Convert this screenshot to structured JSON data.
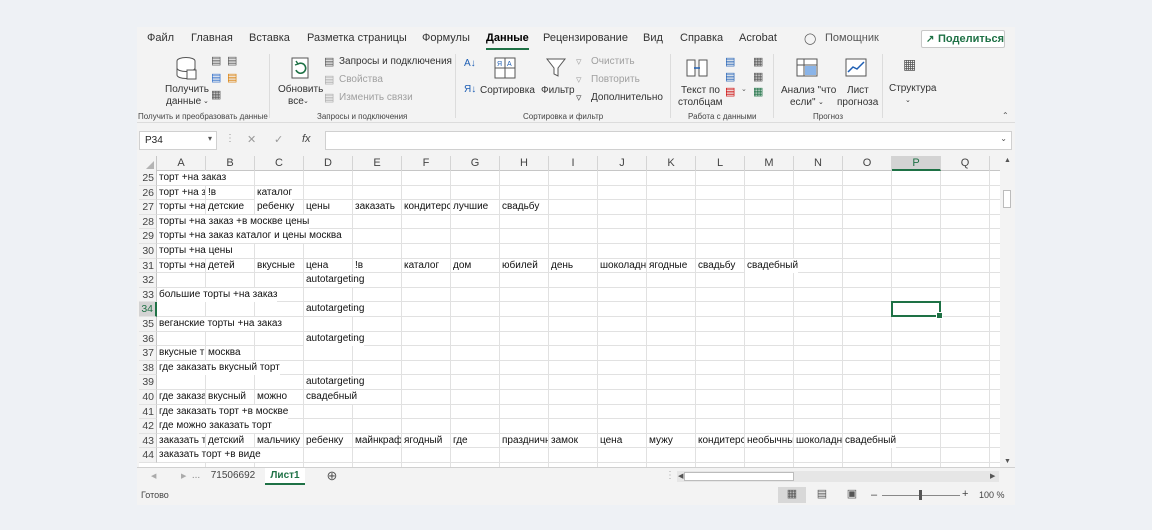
{
  "menu": {
    "tabs": [
      "Файл",
      "Главная",
      "Вставка",
      "Разметка страницы",
      "Формулы",
      "Данные",
      "Рецензирование",
      "Вид",
      "Справка",
      "Acrobat"
    ],
    "active_tab": "Данные",
    "tell_me": "Помощник",
    "share": "Поделиться"
  },
  "ribbon": {
    "get_data": "Получить",
    "get_data2": "данные",
    "group1": "Получить и преобразовать данные",
    "refresh_all": "Обновить",
    "refresh_all2": "все",
    "queries_connections": "Запросы и подключения",
    "properties": "Свойства",
    "edit_links": "Изменить связи",
    "group2": "Запросы и подключения",
    "sort": "Сортировка",
    "filter": "Фильтр",
    "clear": "Очистить",
    "reapply": "Повторить",
    "advanced": "Дополнительно",
    "group3": "Сортировка и фильтр",
    "text_to_columns": "Текст по",
    "text_to_columns2": "столбцам",
    "group4": "Работа с данными",
    "what_if": "Анализ \"что",
    "what_if2": "если\"",
    "forecast_sheet": "Лист",
    "forecast_sheet2": "прогноза",
    "group5": "Прогноз",
    "outline": "Структура"
  },
  "formula_bar": {
    "name_box": "P34",
    "formula": ""
  },
  "grid": {
    "columns": [
      "A",
      "B",
      "C",
      "D",
      "E",
      "F",
      "G",
      "H",
      "I",
      "J",
      "K",
      "L",
      "M",
      "N",
      "O",
      "P",
      "Q"
    ],
    "selected_column": "P",
    "selected_row": "34",
    "rows": [
      {
        "num": "25",
        "cells": [
          [
            "A",
            "торт +на заказ"
          ]
        ]
      },
      {
        "num": "26",
        "cells": [
          [
            "A",
            "торт +на з"
          ],
          [
            "B",
            "!в"
          ],
          [
            "C",
            "каталог"
          ]
        ]
      },
      {
        "num": "27",
        "cells": [
          [
            "A",
            "торты +на"
          ],
          [
            "B",
            "детские"
          ],
          [
            "C",
            "ребенку"
          ],
          [
            "D",
            "цены"
          ],
          [
            "E",
            "заказать"
          ],
          [
            "F",
            "кондитерс"
          ],
          [
            "G",
            "лучшие"
          ],
          [
            "H",
            "свадьбу"
          ]
        ]
      },
      {
        "num": "28",
        "cells": [
          [
            "A",
            "торты +на заказ +в москве цены"
          ]
        ]
      },
      {
        "num": "29",
        "cells": [
          [
            "A",
            "торты +на заказ каталог и цены москва"
          ]
        ]
      },
      {
        "num": "30",
        "cells": [
          [
            "A",
            "торты +на цены"
          ]
        ]
      },
      {
        "num": "31",
        "cells": [
          [
            "A",
            "торты +на"
          ],
          [
            "B",
            "детей"
          ],
          [
            "C",
            "вкусные"
          ],
          [
            "D",
            "цена"
          ],
          [
            "E",
            "!в"
          ],
          [
            "F",
            "каталог"
          ],
          [
            "G",
            "дом"
          ],
          [
            "H",
            "юбилей"
          ],
          [
            "I",
            "день"
          ],
          [
            "J",
            "шоколадн"
          ],
          [
            "K",
            "ягодные"
          ],
          [
            "L",
            "свадьбу"
          ],
          [
            "M",
            "свадебный"
          ]
        ]
      },
      {
        "num": "32",
        "cells": [
          [
            "D",
            "autotargeting"
          ]
        ]
      },
      {
        "num": "33",
        "cells": [
          [
            "A",
            "большие торты +на заказ"
          ]
        ]
      },
      {
        "num": "34",
        "cells": [
          [
            "D",
            "autotargeting"
          ]
        ]
      },
      {
        "num": "35",
        "cells": [
          [
            "A",
            "веганские торты +на заказ"
          ]
        ]
      },
      {
        "num": "36",
        "cells": [
          [
            "D",
            "autotargeting"
          ]
        ]
      },
      {
        "num": "37",
        "cells": [
          [
            "A",
            "вкусные т"
          ],
          [
            "B",
            "москва"
          ]
        ]
      },
      {
        "num": "38",
        "cells": [
          [
            "A",
            "где заказать вкусный торт"
          ]
        ]
      },
      {
        "num": "39",
        "cells": [
          [
            "D",
            "autotargeting"
          ]
        ]
      },
      {
        "num": "40",
        "cells": [
          [
            "A",
            "где заказа"
          ],
          [
            "B",
            "вкусный"
          ],
          [
            "C",
            "можно"
          ],
          [
            "D",
            "свадебный"
          ]
        ]
      },
      {
        "num": "41",
        "cells": [
          [
            "A",
            "где заказать торт +в москве"
          ]
        ]
      },
      {
        "num": "42",
        "cells": [
          [
            "A",
            "где можно заказать торт"
          ]
        ]
      },
      {
        "num": "43",
        "cells": [
          [
            "A",
            "заказать т"
          ],
          [
            "B",
            "детский"
          ],
          [
            "C",
            "мальчику"
          ],
          [
            "D",
            "ребенку"
          ],
          [
            "E",
            "майнкраф"
          ],
          [
            "F",
            "ягодный"
          ],
          [
            "G",
            "где"
          ],
          [
            "H",
            "праздничн"
          ],
          [
            "I",
            "замок"
          ],
          [
            "J",
            "цена"
          ],
          [
            "K",
            "мужу"
          ],
          [
            "L",
            "кондитерс"
          ],
          [
            "M",
            "необычны"
          ],
          [
            "N",
            "шоколадн"
          ],
          [
            "O",
            "свадебный"
          ]
        ]
      },
      {
        "num": "44",
        "cells": [
          [
            "A",
            "заказать торт +в виде"
          ]
        ]
      }
    ]
  },
  "sheets": {
    "tabs": [
      "71506692",
      "Лист1"
    ],
    "active": "Лист1",
    "ellipsis": "..."
  },
  "status": {
    "ready": "Готово",
    "zoom": "100 %"
  }
}
